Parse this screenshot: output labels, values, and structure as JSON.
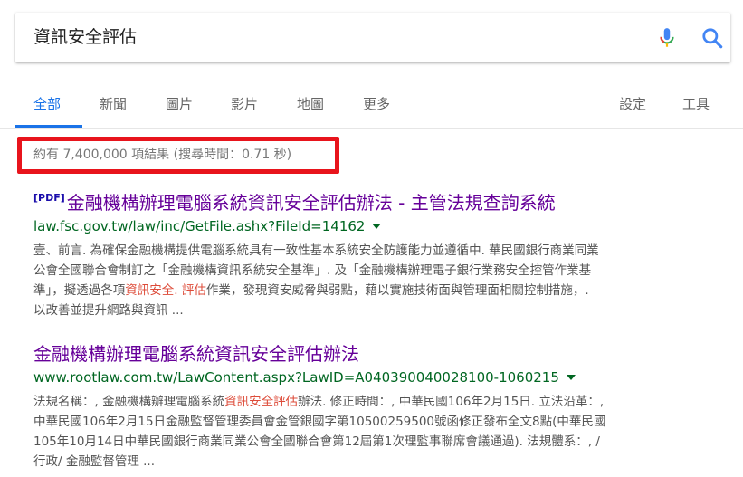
{
  "search": {
    "query": "資訊安全評估"
  },
  "tabs": {
    "all": "全部",
    "news": "新聞",
    "images": "圖片",
    "videos": "影片",
    "maps": "地圖",
    "more": "更多",
    "settings": "設定",
    "tools": "工具"
  },
  "stats": "約有 7,400,000 項結果 (搜尋時間：0.71 秒)",
  "results": [
    {
      "tag": "[PDF]",
      "title": "金融機構辦理電腦系統資訊安全評估辦法 - 主管法規查詢系統",
      "url": "law.fsc.gov.tw/law/inc/GetFile.ashx?FileId=14162",
      "lines": [
        {
          "text": "壹、前言. 為確保金融機構提供電腦系統具有一致性基本系統安全防護能力並遵循中. 華民國銀行商業同業"
        },
        {
          "text": "公會全國聯合會制訂之「金融機構資訊系統安全基準」. 及「金融機構辦理電子銀行業務安全控管作業基"
        },
        {
          "pre": "準」，擬透過各項",
          "hl1": "資訊安全",
          "mid": ". ",
          "hl2": "評估",
          "post": "作業，發現資安威脅與弱點，藉以實施技術面與管理面相關控制措施，."
        },
        {
          "text": "以改善並提升網路與資訊 ..."
        }
      ]
    },
    {
      "title": "金融機構辦理電腦系統資訊安全評估辦法",
      "url": "www.rootlaw.com.tw/LawContent.aspx?LawID=A040390040028100-1060215",
      "lines": [
        {
          "pre": "法規名稱：, 金融機構辦理電腦系統",
          "hl1": "資訊安全評估",
          "post": "辦法. 修正時間：, 中華民國106年2月15日. 立法沿革：,"
        },
        {
          "text": "中華民國106年2月15日金融監督管理委員會金管銀國字第10500259500號函修正發布全文8點(中華民國"
        },
        {
          "text": "105年10月14日中華民國銀行商業同業公會全國聯合會第12屆第1次理監事聯席會議通過). 法規體系：, /"
        },
        {
          "text": "行政/ 金融監督管理 ..."
        }
      ]
    }
  ],
  "colors": {
    "accent": "#1a73e8",
    "visited_title": "#660099",
    "url": "#006621",
    "highlight": "#dd4b39",
    "callout_box": "#e8141c"
  }
}
